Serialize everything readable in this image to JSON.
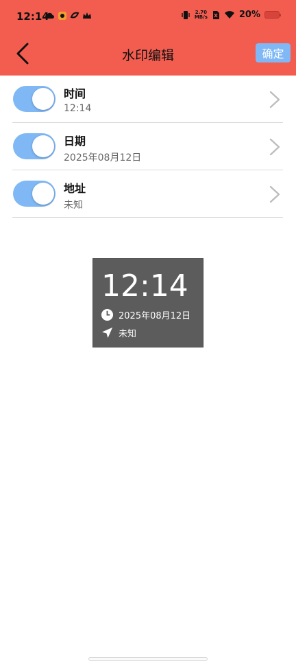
{
  "status_bar": {
    "time": "12:14",
    "net_speed_value": "2.70",
    "net_speed_unit": "MB/s",
    "battery": "20%",
    "left_icons": [
      "cloud-icon",
      "app-icon",
      "link-icon",
      "crown-icon"
    ],
    "right_icons": [
      "vibrate-icon",
      "no-sim-icon",
      "wifi-icon",
      "battery-icon"
    ]
  },
  "header": {
    "title": "水印编辑",
    "confirm_label": "确定",
    "back_icon": "chevron-left-icon"
  },
  "rows": [
    {
      "label": "时间",
      "value": "12:14",
      "enabled": true
    },
    {
      "label": "日期",
      "value": "2025年08月12日",
      "enabled": true
    },
    {
      "label": "地址",
      "value": "未知",
      "enabled": true
    }
  ],
  "preview": {
    "time": "12:14",
    "date": "2025年08月12日",
    "address": "未知"
  },
  "colors": {
    "header_bg": "#f25d50",
    "accent": "#7fb8f5",
    "preview_bg": "#5c5c5c"
  }
}
